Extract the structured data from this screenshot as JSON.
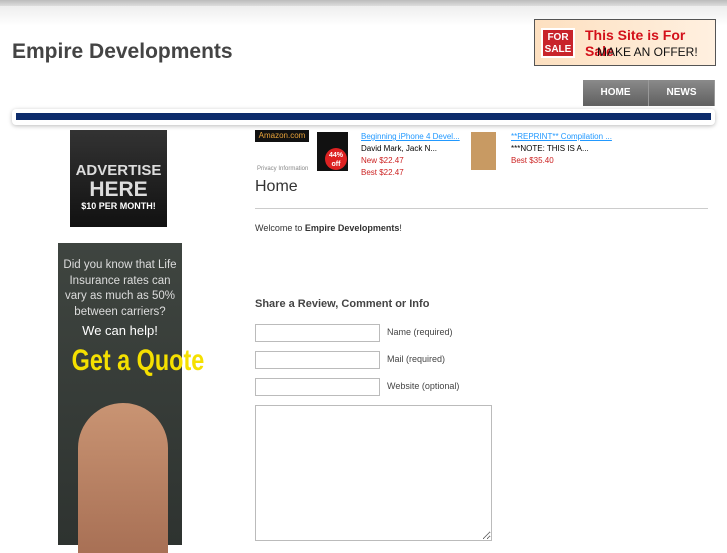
{
  "site": {
    "title": "Empire Developments"
  },
  "for_sale": {
    "sign": "FOR SALE",
    "line1": "This Site is For Sale",
    "line2": "MAKE AN OFFER!"
  },
  "nav": [
    {
      "label": "HOME"
    },
    {
      "label": "NEWS"
    }
  ],
  "ads": {
    "advertise": {
      "line1": "ADVERTISE",
      "line2": "HERE",
      "line3": "$10 PER MONTH!"
    },
    "insurance": {
      "text": "Did you know that Life Insurance rates can vary as much as 50% between carriers?",
      "help": "We can help!",
      "cta": "Get a Quote"
    }
  },
  "amazon": {
    "logo": "Amazon.com",
    "privacy": "Privacy Information",
    "products": [
      {
        "title": "Beginning iPhone 4 Devel...",
        "author": "David Mark, Jack N...",
        "new": "New $22.47",
        "best": "Best $22.47",
        "badge": "44% off"
      },
      {
        "title": "**REPRINT** Compilation ...",
        "author": "***NOTE: THIS IS A...",
        "best": "Best $35.40"
      }
    ]
  },
  "page": {
    "heading": "Home",
    "welcome_prefix": "Welcome to ",
    "welcome_bold": "Empire Developments",
    "welcome_suffix": "!"
  },
  "form": {
    "heading": "Share a Review, Comment or Info",
    "name_label": "Name (required)",
    "mail_label": "Mail (required)",
    "website_label": "Website (optional)",
    "name": "",
    "mail": "",
    "website": "",
    "comment": ""
  }
}
